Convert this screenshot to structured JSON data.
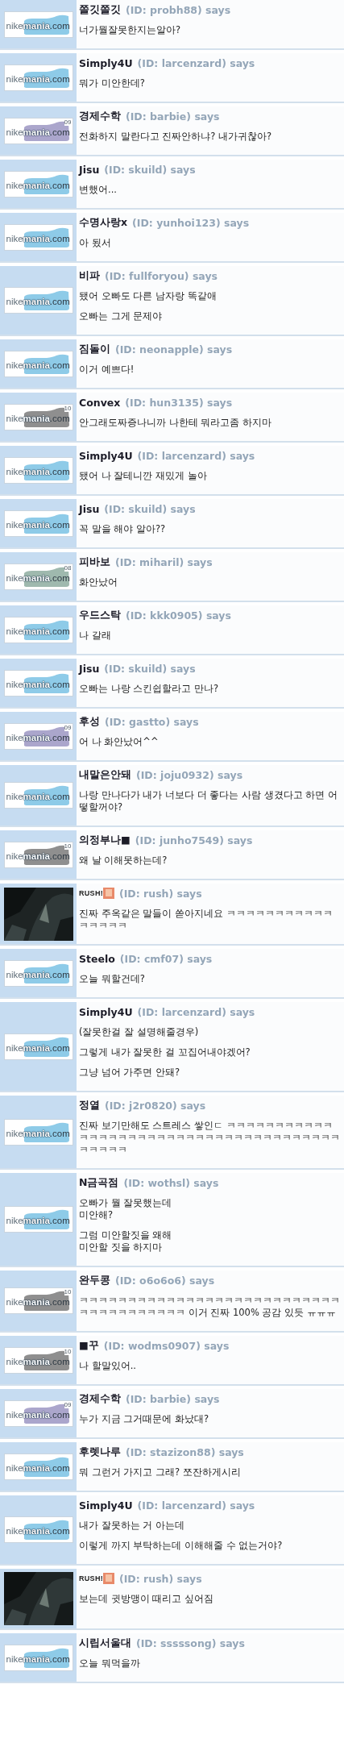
{
  "comments": [
    {
      "name": "쫄깃쫄깃",
      "id_text": "(ID: probh88) says",
      "avatar": {
        "kind": "logo",
        "logo": [
          "nike",
          "mania",
          ".com"
        ],
        "color": "#8ecbe8"
      },
      "paragraphs": [
        "너가뭘잘못한지는알아?"
      ]
    },
    {
      "name": "Simply4U",
      "id_text": "(ID: larcenzard) says",
      "avatar": {
        "kind": "logo",
        "logo": [
          "nike",
          "mania",
          ".com"
        ],
        "color": "#8ecbe8"
      },
      "paragraphs": [
        "뭐가 미안한데?"
      ]
    },
    {
      "name": "경제수학",
      "id_text": "(ID: barbie) says",
      "avatar": {
        "kind": "logo",
        "logo": [
          "nike",
          "mania",
          ".com"
        ],
        "color": "#aba6cc",
        "badge": "09"
      },
      "paragraphs": [
        "전화하지 말란다고 진짜안하냐? 내가귀찮아?"
      ]
    },
    {
      "name": "Jisu",
      "id_text": "(ID: skuild) says",
      "avatar": {
        "kind": "logo",
        "logo": [
          "nike",
          "mania",
          ".com"
        ],
        "color": "#8ecbe8"
      },
      "paragraphs": [
        "변했어..."
      ]
    },
    {
      "name": "수명사랑x",
      "id_text": "(ID: yunhoi123) says",
      "avatar": {
        "kind": "logo",
        "logo": [
          "nike",
          "mania",
          ".com"
        ],
        "color": "#8ecbe8"
      },
      "paragraphs": [
        "아 됬서"
      ]
    },
    {
      "name": "비파",
      "id_text": "(ID: fullforyou) says",
      "avatar": {
        "kind": "logo",
        "logo": [
          "nike",
          "mania",
          ".com"
        ],
        "color": "#8ecbe8"
      },
      "paragraphs": [
        "됐어 오빠도 다른 남자랑 똑같애",
        "오빠는 그게 문제야"
      ]
    },
    {
      "name": "짐돌이",
      "id_text": "(ID: neonapple) says",
      "avatar": {
        "kind": "logo",
        "logo": [
          "nike",
          "mania",
          ".com"
        ],
        "color": "#8ecbe8"
      },
      "paragraphs": [
        "이거 예쁘다!"
      ]
    },
    {
      "name": "Convex",
      "id_text": "(ID: hun3135) says",
      "avatar": {
        "kind": "logo",
        "logo": [
          "nike",
          "mania",
          ".com"
        ],
        "color": "#8f8f8f",
        "badge": "10"
      },
      "paragraphs": [
        "안그래도짜증나니까 나한테 뭐라고좀 하지마"
      ]
    },
    {
      "name": "Simply4U",
      "id_text": "(ID: larcenzard) says",
      "avatar": {
        "kind": "logo",
        "logo": [
          "nike",
          "mania",
          ".com"
        ],
        "color": "#8ecbe8"
      },
      "paragraphs": [
        "됐어 나 잘테니깐 재밌게 놀아"
      ]
    },
    {
      "name": "Jisu",
      "id_text": "(ID: skuild) says",
      "avatar": {
        "kind": "logo",
        "logo": [
          "nike",
          "mania",
          ".com"
        ],
        "color": "#8ecbe8"
      },
      "paragraphs": [
        "꼭 말을 해야 알아??"
      ]
    },
    {
      "name": "피바보",
      "id_text": "(ID: miharil) says",
      "avatar": {
        "kind": "logo",
        "logo": [
          "nike",
          "mania",
          ".com"
        ],
        "color": "#9fb9ae",
        "badge": "08"
      },
      "paragraphs": [
        "화안났어"
      ]
    },
    {
      "name": "우드스탁",
      "id_text": "(ID: kkk0905) says",
      "avatar": {
        "kind": "logo",
        "logo": [
          "nike",
          "mania",
          ".com"
        ],
        "color": "#8ecbe8"
      },
      "paragraphs": [
        "나 갈래"
      ]
    },
    {
      "name": "Jisu",
      "id_text": "(ID: skuild) says",
      "avatar": {
        "kind": "logo",
        "logo": [
          "nike",
          "mania",
          ".com"
        ],
        "color": "#8ecbe8"
      },
      "paragraphs": [
        "오빠는 나랑 스킨쉽할라고 만나?"
      ]
    },
    {
      "name": "후성",
      "id_text": "(ID: gastto) says",
      "avatar": {
        "kind": "logo",
        "logo": [
          "nike",
          "mania",
          ".com"
        ],
        "color": "#aba6cc",
        "badge": "09"
      },
      "paragraphs": [
        "어 나 화안났어^^"
      ]
    },
    {
      "name": "내말은안돼",
      "id_text": "(ID: joju0932) says",
      "avatar": {
        "kind": "logo",
        "logo": [
          "nike",
          "mania",
          ".com"
        ],
        "color": "#8ecbe8"
      },
      "paragraphs": [
        "나랑 만나다가 내가 너보다 더 좋다는 사람 생겼다고 하면 어떻할꺼야?"
      ]
    },
    {
      "name": "의정부나■",
      "id_text": "(ID: junho7549) says",
      "avatar": {
        "kind": "logo",
        "logo": [
          "nike",
          "mania",
          ".com"
        ],
        "color": "#8f8f8f",
        "badge": "10"
      },
      "paragraphs": [
        "왜 날 이해못하는데?"
      ]
    },
    {
      "name": "RUSH!",
      "name_icon": true,
      "id_text": "(ID: rush) says",
      "avatar": {
        "kind": "picture"
      },
      "paragraphs": [
        "진짜 주옥같은 말들이 쏟아지네요 ㅋㅋㅋㅋㅋㅋㅋㅋㅋㅋㅋㅋㅋㅋㅋㅋ"
      ]
    },
    {
      "name": "Steelo",
      "id_text": "(ID: cmf07) says",
      "avatar": {
        "kind": "logo",
        "logo": [
          "nike",
          "mania",
          ".com"
        ],
        "color": "#8ecbe8"
      },
      "paragraphs": [
        "오늘 뭐할건데?"
      ]
    },
    {
      "name": "Simply4U",
      "id_text": "(ID: larcenzard) says",
      "avatar": {
        "kind": "logo",
        "logo": [
          "nike",
          "mania",
          ".com"
        ],
        "color": "#8ecbe8"
      },
      "paragraphs": [
        "(잘못한걸 잘 설명해줄경우)",
        "그렇게 내가 잘못한 걸 꼬집어내야겠어?",
        "그냥 넘어 가주면 안돼?"
      ]
    },
    {
      "name": "정열",
      "id_text": "(ID: j2r0820) says",
      "avatar": {
        "kind": "logo",
        "logo": [
          "nike",
          "mania",
          ".com"
        ],
        "color": "#8ecbe8"
      },
      "paragraphs": [
        "진짜 보기만해도 스트레스 쌓인ㄷ ㅋㅋㅋㅋㅋㅋㅋㅋㅋㅋㅋㅋㅋㅋㅋㅋㅋㅋㅋㅋㅋㅋㅋㅋㅋㅋㅋㅋㅋㅋㅋㅋㅋㅋㅋㅋㅋㅋㅋㅋㅋㅋㅋ"
      ]
    },
    {
      "name": "N금곡점",
      "id_text": "(ID: wothsl) says",
      "avatar": {
        "kind": "logo",
        "logo": [
          "nike",
          "mania",
          ".com"
        ],
        "color": "#8ecbe8"
      },
      "paragraphs": [
        "오빠가 뭘 잘못했는데\n미안해?",
        "그럼 미안할짓을 왜해\n미안할 짓을 하지마"
      ]
    },
    {
      "name": "완두콩",
      "id_text": "(ID: o6o6o6) says",
      "avatar": {
        "kind": "logo",
        "logo": [
          "nike",
          "mania",
          ".com"
        ],
        "color": "#8f8f8f",
        "badge": "10"
      },
      "paragraphs": [
        "ㅋㅋㅋㅋㅋㅋㅋㅋㅋㅋㅋㅋㅋㅋㅋㅋㅋㅋㅋㅋㅋㅋㅋㅋㅋㅋㅋㅋㅋㅋㅋㅋㅋㅋㅋㅋㅋㅋ 이거 진짜 100% 공감 있듯 ㅠㅠㅠ"
      ]
    },
    {
      "name": "■꾸",
      "id_text": "(ID: wodms0907) says",
      "avatar": {
        "kind": "logo",
        "logo": [
          "nike",
          "mania",
          ".com"
        ],
        "color": "#8f8f8f",
        "badge": "10"
      },
      "paragraphs": [
        "나 할말있어.."
      ]
    },
    {
      "name": "경제수학",
      "id_text": "(ID: barbie) says",
      "avatar": {
        "kind": "logo",
        "logo": [
          "nike",
          "mania",
          ".com"
        ],
        "color": "#aba6cc",
        "badge": "09"
      },
      "paragraphs": [
        "누가 지금 그거때문에 화났대?"
      ]
    },
    {
      "name": "후렛나루",
      "id_text": "(ID: stazizon88) says",
      "avatar": {
        "kind": "logo",
        "logo": [
          "nike",
          "mania",
          ".com"
        ],
        "color": "#8ecbe8"
      },
      "paragraphs": [
        "뭐 그런거 가지고 그래? 쪼잔하게시리"
      ]
    },
    {
      "name": "Simply4U",
      "id_text": "(ID: larcenzard) says",
      "avatar": {
        "kind": "logo",
        "logo": [
          "nike",
          "mania",
          ".com"
        ],
        "color": "#8ecbe8"
      },
      "paragraphs": [
        "내가 잘못하는 거 아는데",
        "이렇게 까지 부탁하는데 이해해줄 수 없는거야?"
      ]
    },
    {
      "name": "RUSH!",
      "name_icon": true,
      "id_text": "(ID: rush) says",
      "avatar": {
        "kind": "picture"
      },
      "paragraphs": [
        "보는데 귓방맹이 때리고 싶어짐"
      ]
    },
    {
      "name": "시립서울대",
      "id_text": "(ID: sssssong) says",
      "avatar": {
        "kind": "logo",
        "logo": [
          "nike",
          "mania",
          ".com"
        ],
        "color": "#8ecbe8"
      },
      "paragraphs": [
        "오늘 뭐먹을까"
      ]
    }
  ]
}
